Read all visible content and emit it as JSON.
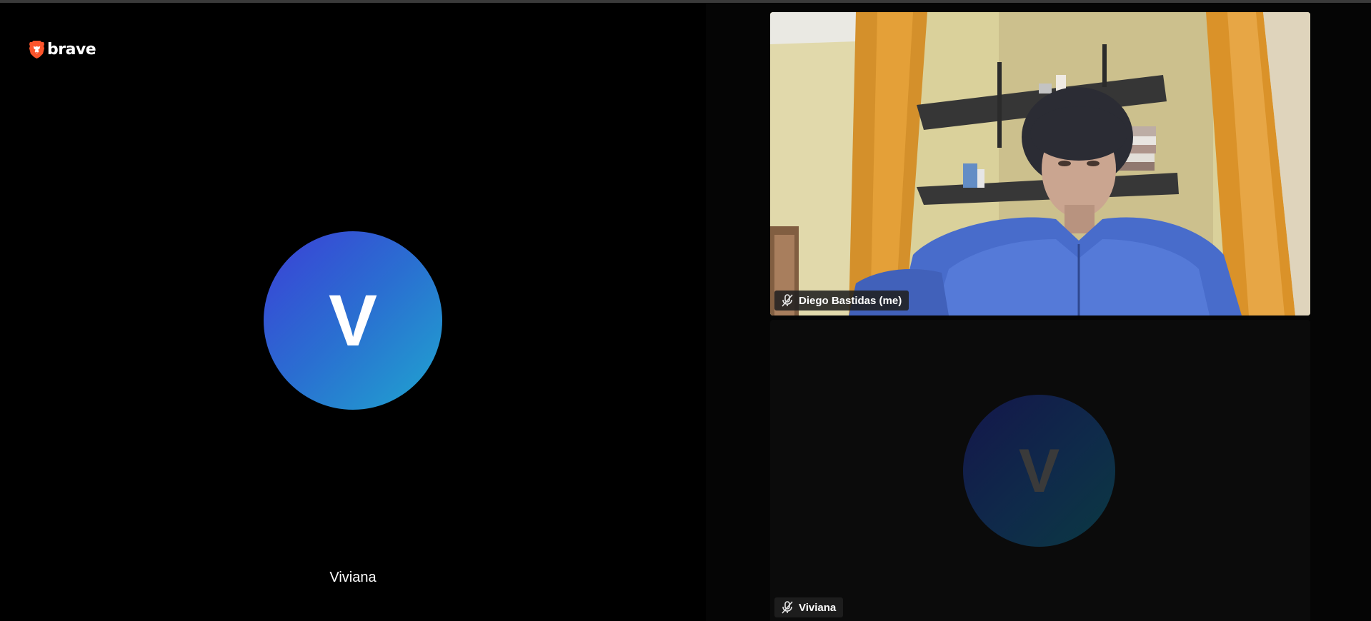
{
  "brand": {
    "name": "brave",
    "color": "#fb542b"
  },
  "main_stage": {
    "avatar_initial": "V",
    "participant_name": "Viviana"
  },
  "tiles": [
    {
      "participant_name": "Diego Bastidas (me)",
      "mic_icon": "mic-muted-icon",
      "type": "video"
    },
    {
      "participant_name": "Viviana",
      "avatar_initial": "V",
      "mic_icon": "mic-muted-icon",
      "type": "avatar"
    }
  ],
  "colors": {
    "background": "#000000",
    "pill_background": "#202020",
    "avatar_gradient_start": "#3b3fd6",
    "avatar_gradient_end": "#1fa6cf"
  }
}
